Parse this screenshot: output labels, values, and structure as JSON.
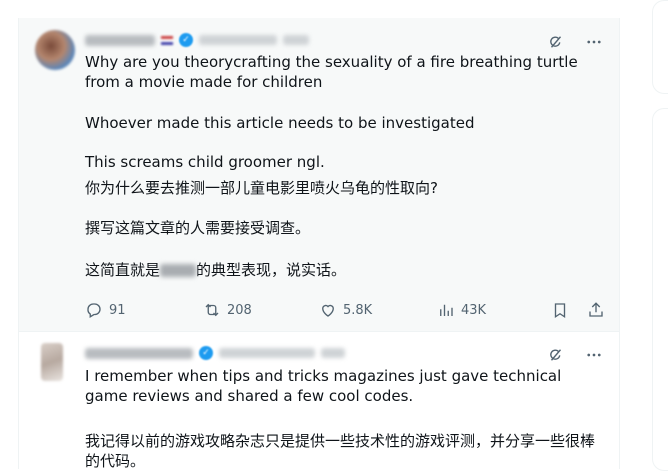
{
  "posts": [
    {
      "paragraphs": [
        "Why are you theorycrafting the sexuality of a fire breathing turtle from a movie made for children",
        "Whoever made this article needs to be investigated",
        "This screams child groomer ngl.",
        "你为什么要去推测一部儿童电影里喷火乌龟的性取向?",
        "撰写这篇文章的人需要接受调查。"
      ],
      "last_line_prefix": "这简直就是",
      "last_line_suffix": "的典型表现，说实话。",
      "stats": {
        "replies": "91",
        "reposts": "208",
        "likes": "5.8K",
        "views": "43K"
      }
    },
    {
      "paragraphs": [
        "I remember when tips and tricks magazines just gave technical game reviews and shared a few cool codes.",
        "我记得以前的游戏攻略杂志只是提供一些技术性的游戏评测，并分享一些很棒的代码。"
      ]
    }
  ],
  "icons": {
    "grok": "grok-icon",
    "more": "more-icon",
    "reply": "reply-icon",
    "repost": "repost-icon",
    "like": "like-icon",
    "views": "views-icon",
    "bookmark": "bookmark-icon",
    "share": "share-icon"
  },
  "colors": {
    "text": "#0f1419",
    "muted": "#536471",
    "verified": "#1d9bf0",
    "border": "#eff3f4"
  }
}
